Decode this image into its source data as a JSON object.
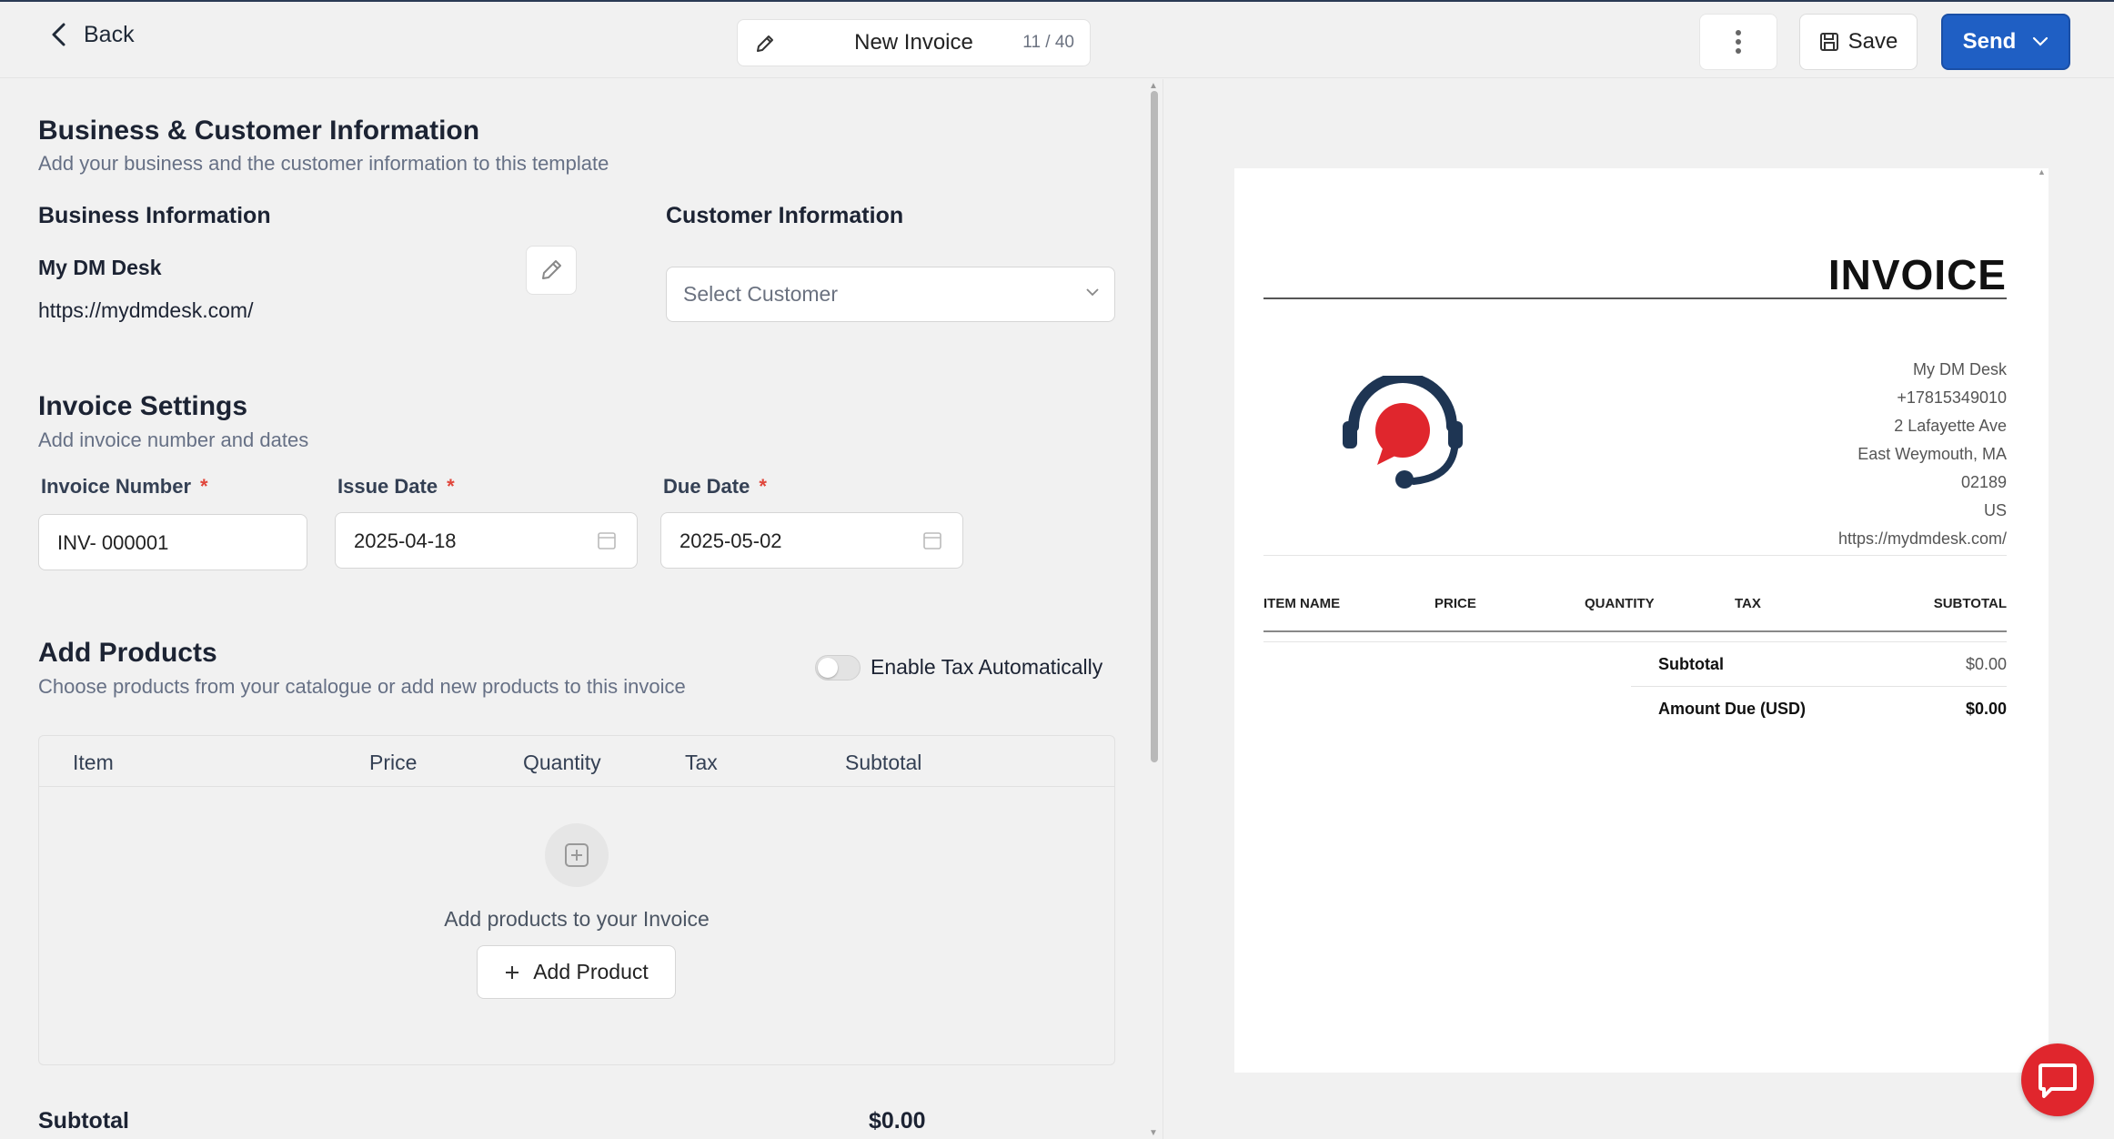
{
  "header": {
    "back_label": "Back",
    "doc_title": "New Invoice",
    "char_count": "11 / 40",
    "save_label": "Save",
    "send_label": "Send",
    "accent_color": "#1f5fc4"
  },
  "business_customer": {
    "title": "Business & Customer Information",
    "subtitle": "Add your business and the customer information to this template",
    "business_heading": "Business Information",
    "business_name": "My DM Desk",
    "business_url": "https://mydmdesk.com/",
    "customer_heading": "Customer Information",
    "customer_placeholder": "Select Customer"
  },
  "invoice_settings": {
    "title": "Invoice Settings",
    "subtitle": "Add invoice number and dates",
    "number_label": "Invoice Number",
    "number_value": "INV- 000001",
    "issue_label": "Issue Date",
    "issue_value": "2025-04-18",
    "due_label": "Due Date",
    "due_value": "2025-05-02",
    "required_mark": "*"
  },
  "products": {
    "title": "Add Products",
    "subtitle": "Choose products from your catalogue or add new products to this invoice",
    "tax_toggle_label": "Enable Tax Automatically",
    "tax_toggle_on": false,
    "columns": [
      "Item",
      "Price",
      "Quantity",
      "Tax",
      "Subtotal"
    ],
    "empty_text": "Add products to your Invoice",
    "add_label": "Add Product"
  },
  "summary": {
    "subtotal_label": "Subtotal",
    "subtotal_value": "$0.00"
  },
  "preview": {
    "title": "INVOICE",
    "business_lines": [
      "My DM Desk",
      "+17815349010",
      "2 Lafayette Ave",
      "East Weymouth, MA",
      "02189",
      "US",
      "https://mydmdesk.com/"
    ],
    "columns": [
      "ITEM NAME",
      "PRICE",
      "QUANTITY",
      "TAX",
      "SUBTOTAL"
    ],
    "subtotal_label": "Subtotal",
    "subtotal_value": "$0.00",
    "amount_due_label": "Amount Due (USD)",
    "amount_due_value": "$0.00",
    "logo_colors": {
      "ring": "#1e3553",
      "bubble": "#e0262d"
    }
  },
  "chat_widget": {
    "icon": "chat-bubble-icon",
    "color": "#e0262d"
  }
}
